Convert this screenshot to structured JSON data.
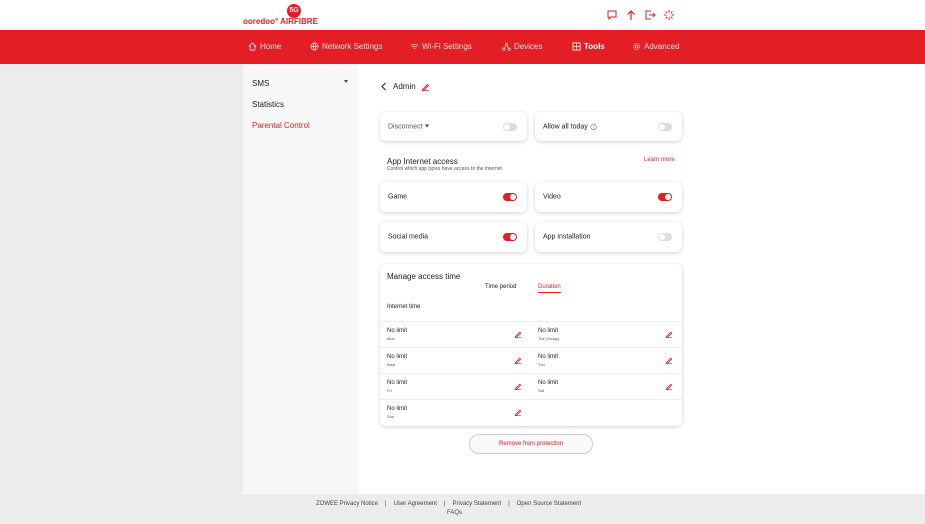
{
  "header": {
    "logo_badge": "5G",
    "logo_ooredoo": "ooredoo°",
    "logo_airfibre": "AIRFIBRE"
  },
  "nav": {
    "items": [
      {
        "label": "Home",
        "icon": "home-icon"
      },
      {
        "label": "Network Settings",
        "icon": "globe-icon"
      },
      {
        "label": "Wi-Fi Settings",
        "icon": "wifi-icon"
      },
      {
        "label": "Devices",
        "icon": "devices-icon"
      },
      {
        "label": "Tools",
        "icon": "tools-icon"
      },
      {
        "label": "Advanced",
        "icon": "gear-icon"
      }
    ],
    "active": "Tools"
  },
  "sidebar": {
    "items": [
      {
        "label": "SMS"
      },
      {
        "label": "Statistics"
      },
      {
        "label": "Parental Control"
      }
    ]
  },
  "page": {
    "back_label": "Admin",
    "disconnect_label": "Disconnect",
    "allow_all_today_label": "Allow all today",
    "app_access_title": "App Internet access",
    "app_access_subtitle": "Control which app types have access to the Internet.",
    "learn_more": "Learn more",
    "apps": [
      {
        "label": "Game",
        "on": true
      },
      {
        "label": "Video",
        "on": true
      },
      {
        "label": "Social media",
        "on": true
      },
      {
        "label": "App installation",
        "on": false
      }
    ],
    "disconnect_on": false,
    "allow_all_on": false
  },
  "access": {
    "title": "Manage access time",
    "tabs": [
      "Time period",
      "Duration"
    ],
    "active_tab": "Duration",
    "internet_time_label": "Internet time",
    "days": [
      {
        "value": "No limit",
        "day": "Mon"
      },
      {
        "value": "No limit",
        "day": "Tue (Today)"
      },
      {
        "value": "No limit",
        "day": "Wed"
      },
      {
        "value": "No limit",
        "day": "Thu"
      },
      {
        "value": "No limit",
        "day": "Fri"
      },
      {
        "value": "No limit",
        "day": "Sat"
      },
      {
        "value": "No limit",
        "day": "Sun"
      }
    ]
  },
  "remove_button": "Remove from protection",
  "footer": {
    "links": [
      "ZOWEE Privacy Notice",
      "User Agreement",
      "Privacy Statement",
      "Open Source Statement"
    ],
    "separator": "|",
    "faqs": "FAQs"
  },
  "colors": {
    "brand_red": "#e31e24"
  }
}
